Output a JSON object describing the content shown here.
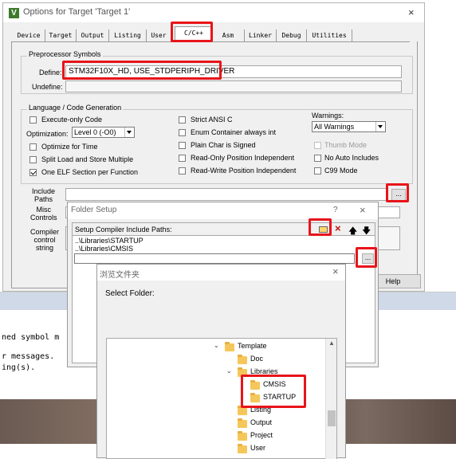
{
  "options_dialog": {
    "title": "Options for Target 'Target 1'",
    "tabs": [
      "Device",
      "Target",
      "Output",
      "Listing",
      "User",
      "C/C++",
      "Asm",
      "Linker",
      "Debug",
      "Utilities"
    ],
    "preprocessor_group": "Preprocessor Symbols",
    "define_label": "Define:",
    "define_value": "STM32F10X_HD, USE_STDPERIPH_DRIVER",
    "undefine_label": "Undefine:",
    "language_group": "Language / Code Generation",
    "execute_only": "Execute-only Code",
    "optimization_label": "Optimization:",
    "optimization_value": "Level 0 (-O0)",
    "optimize_time": "Optimize for Time",
    "split_load": "Split Load and Store Multiple",
    "one_elf": "One ELF Section per Function",
    "strict_ansi": "Strict ANSI C",
    "enum_container": "Enum Container always int",
    "plain_char": "Plain Char is Signed",
    "ro_pos": "Read-Only Position Independent",
    "rw_pos": "Read-Write Position Independent",
    "warnings_label": "Warnings:",
    "warnings_value": "All Warnings",
    "thumb_mode": "Thumb Mode",
    "no_auto_includes": "No Auto Includes",
    "c99_mode": "C99 Mode",
    "include_paths_label": "Include\nPaths",
    "misc_controls_label": "Misc\nControls",
    "compiler_control_label": "Compiler\ncontrol\nstring",
    "browse_label": "...",
    "help_label": "Help"
  },
  "folder_setup": {
    "title": "Folder Setup",
    "help_glyph": "?",
    "close_glyph": "X",
    "heading": "Setup Compiler Include Paths:",
    "paths": [
      "..\\Libraries\\STARTUP",
      "..\\Libraries\\CMSIS"
    ],
    "browse_label": "..."
  },
  "browse_folder": {
    "title": "浏览文件夹",
    "close_glyph": "X",
    "prompt": "Select Folder:",
    "tree": {
      "root": "Template",
      "children": [
        "Doc",
        "Libraries",
        "CMSIS",
        "STARTUP",
        "Listing",
        "Output",
        "Project",
        "User"
      ]
    }
  },
  "background_output": {
    "line1": "ned symbol m",
    "line2": "r messages.",
    "line3": "ing(s)."
  },
  "colors": {
    "highlight": "#e8141a",
    "dialog_bg": "#f0f0f0",
    "folder_yellow": "#f5c75b"
  }
}
